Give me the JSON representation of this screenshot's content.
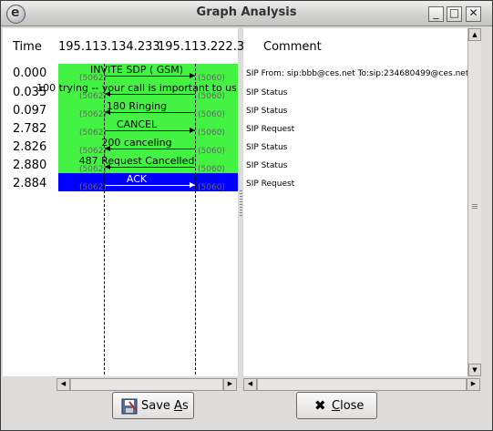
{
  "window": {
    "title": "Graph Analysis"
  },
  "graph": {
    "time_header": "Time",
    "nodes": [
      "195.113.134.233",
      "195.113.222.3"
    ],
    "times": [
      "0.000",
      "0.035",
      "0.097",
      "2.782",
      "2.826",
      "2.880",
      "2.884"
    ],
    "messages": [
      {
        "label": "INVITE SDP ( GSM)",
        "direction": "right",
        "src_port": "(5062)",
        "dst_port": "(5060)"
      },
      {
        "label": "100 trying -- your call is important to us",
        "direction": "left",
        "src_port": "(5062)",
        "dst_port": "(5060)"
      },
      {
        "label": "180 Ringing",
        "direction": "left",
        "src_port": "(5062)",
        "dst_port": "(5060)"
      },
      {
        "label": "CANCEL",
        "direction": "right",
        "src_port": "(5062)",
        "dst_port": "(5060)"
      },
      {
        "label": "200 canceling",
        "direction": "left",
        "src_port": "(5062)",
        "dst_port": "(5060)"
      },
      {
        "label": "487 Request Cancelled",
        "direction": "left",
        "src_port": "(5062)",
        "dst_port": "(5060)"
      },
      {
        "label": "ACK",
        "direction": "right",
        "src_port": "(5062)",
        "dst_port": "(5060)"
      }
    ],
    "colors": {
      "call_green": "#44f244",
      "selected_blue": "#0000ff"
    }
  },
  "comments": {
    "header": "Comment",
    "items": [
      "SIP From: sip:bbb@ces.net To:sip:234680499@ces.net",
      "SIP Status",
      "SIP Status",
      "SIP Request",
      "SIP Status",
      "SIP Status",
      "SIP Request"
    ]
  },
  "buttons": {
    "save_as": {
      "pre": "Save ",
      "accel": "A",
      "post": "s",
      "icon": "floppy-save-icon"
    },
    "close": {
      "pre": "",
      "accel": "C",
      "post": "lose",
      "icon": "x-close-icon"
    }
  },
  "window_controls": {
    "minimize": "_",
    "maximize": "□",
    "close": "✕"
  }
}
